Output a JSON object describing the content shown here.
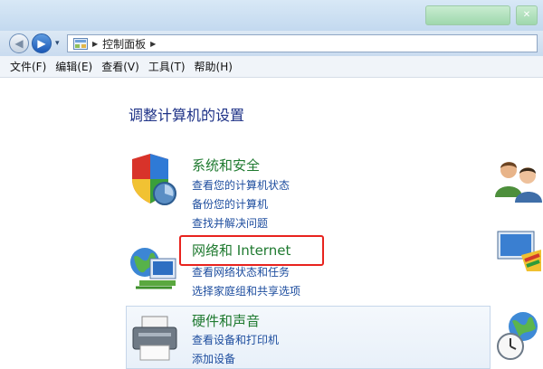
{
  "titlebar": {
    "share_button": "",
    "close_button": "✕"
  },
  "navbar": {
    "back_glyph": "◀",
    "forward_glyph": "▶",
    "dropdown_glyph": "▾",
    "breadcrumb": "控制面板",
    "crumb_arrow": "▶"
  },
  "menu": {
    "items": [
      "文件(F)",
      "编辑(E)",
      "查看(V)",
      "工具(T)",
      "帮助(H)"
    ]
  },
  "main": {
    "title": "调整计算机的设置",
    "categories": [
      {
        "title": "系统和安全",
        "icon": "shield-icon",
        "links": [
          "查看您的计算机状态",
          "备份您的计算机",
          "查找并解决问题"
        ]
      },
      {
        "title": "网络和 Internet",
        "icon": "network-icon",
        "links": [
          "查看网络状态和任务",
          "选择家庭组和共享选项"
        ]
      },
      {
        "title": "硬件和声音",
        "icon": "printer-icon",
        "links": [
          "查看设备和打印机",
          "添加设备"
        ]
      }
    ],
    "right_icons": [
      "user-accounts-icon",
      "appearance-icon",
      "clock-region-icon"
    ]
  },
  "colors": {
    "category_title": "#1f7a30",
    "link": "#1c4c9e",
    "page_title": "#1e3287",
    "highlight": "#e8231e"
  }
}
